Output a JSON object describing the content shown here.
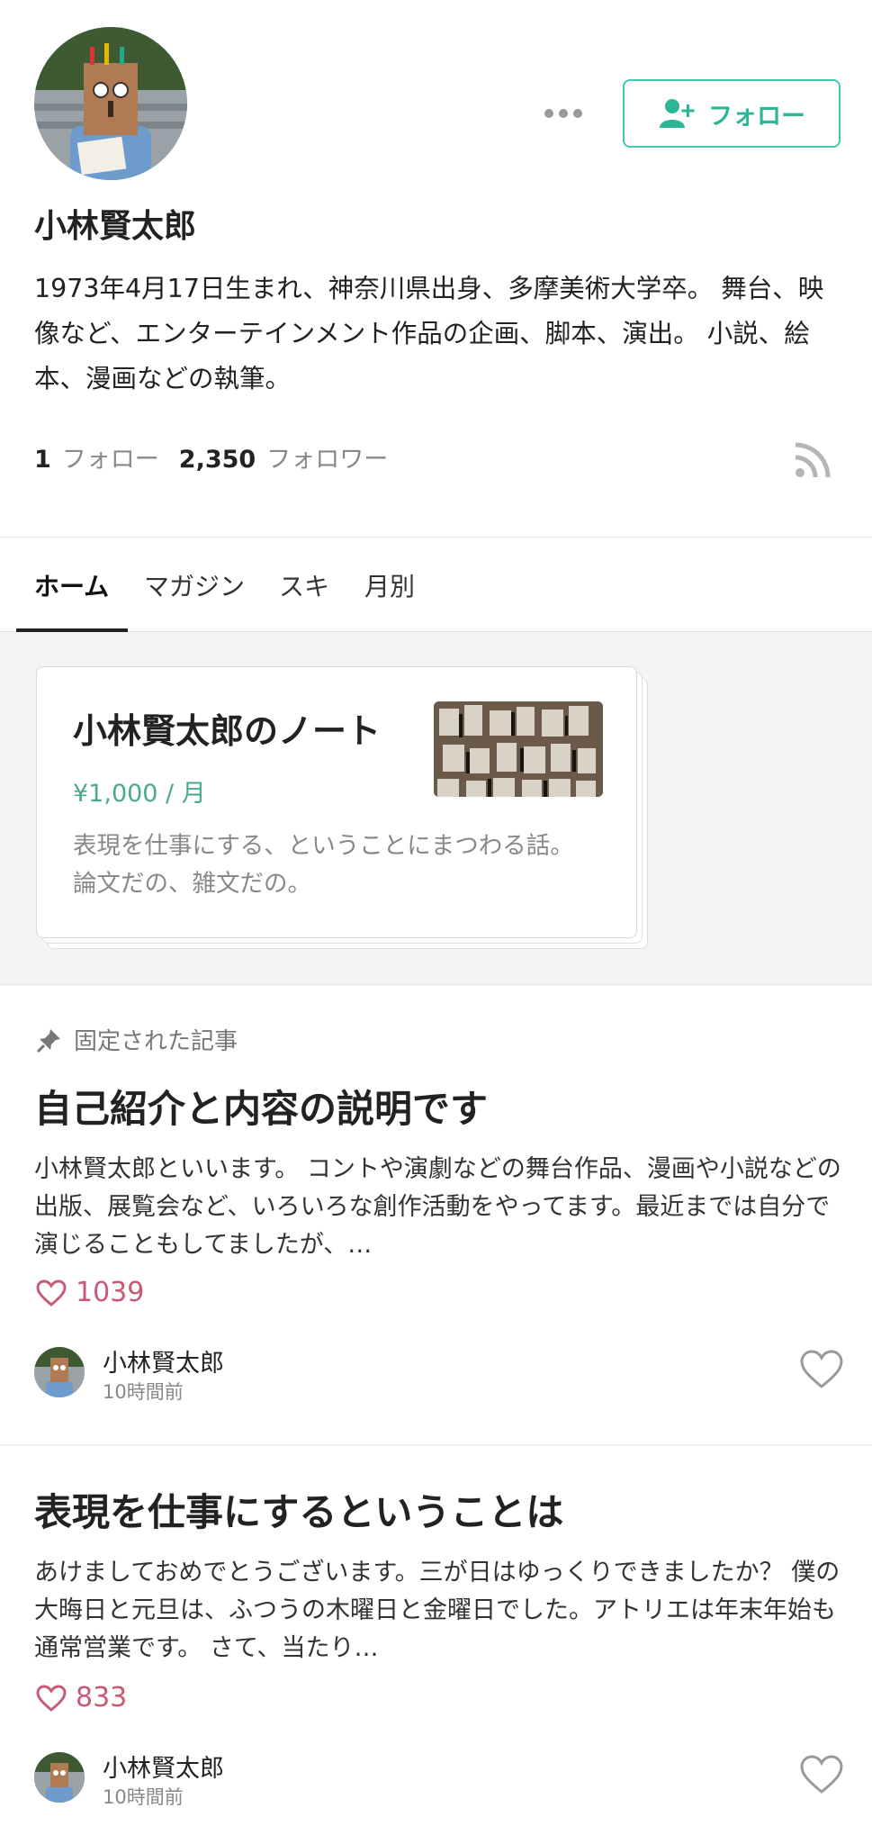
{
  "profile": {
    "name": "小林賢太郎",
    "bio": "1973年4月17日生まれ、神奈川県出身、多摩美術大学卒。 舞台、映像など、エンターテインメント作品の企画、脚本、演出。 小説、絵本、漫画などの執筆。",
    "follow_button": "フォロー",
    "following_count": "1",
    "following_label": "フォロー",
    "followers_count": "2,350",
    "followers_label": "フォロワー"
  },
  "tabs": [
    {
      "label": "ホーム",
      "active": true
    },
    {
      "label": "マガジン",
      "active": false
    },
    {
      "label": "スキ",
      "active": false
    },
    {
      "label": "月別",
      "active": false
    }
  ],
  "magazine": {
    "title": "小林賢太郎のノート",
    "price": "¥1,000 / 月",
    "description": "表現を仕事にする、ということにまつわる話。 論文だの、雑文だの。"
  },
  "articles": [
    {
      "pinned_label": "固定された記事",
      "title": "自己紹介と内容の説明です",
      "excerpt": "小林賢太郎といいます。 コントや演劇などの舞台作品、漫画や小説などの出版、展覧会など、いろいろな創作活動をやってます。最近までは自分で演じることもしてましたが、…",
      "likes": "1039",
      "author": "小林賢太郎",
      "time": "10時間前"
    },
    {
      "title": "表現を仕事にするということは",
      "excerpt": "あけましておめでとうございます。三が日はゆっくりできましたか？ 僕の大晦日と元旦は、ふつうの木曜日と金曜日でした。アトリエは年末年始も通常営業です。 さて、当たり…",
      "likes": "833",
      "author": "小林賢太郎",
      "time": "10時間前"
    }
  ],
  "colors": {
    "accent": "#2cb696",
    "like": "#c85a76",
    "price": "#49a98e"
  }
}
